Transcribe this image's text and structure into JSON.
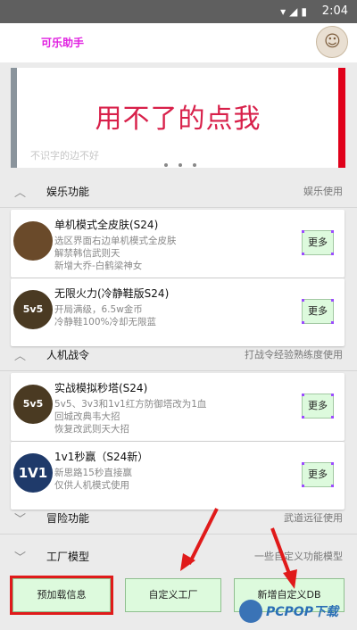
{
  "status_bar": {
    "time": "2:04",
    "icons": [
      "wifi-icon",
      "signal-icon",
      "battery-icon"
    ]
  },
  "app": {
    "title": "可乐助手",
    "avatar_icon": "avatar-icon"
  },
  "banner": {
    "text": "用不了的点我",
    "subtext": "不识字的边不好"
  },
  "sections": [
    {
      "title": "娱乐功能",
      "note": "娱乐使用",
      "icon": "chevron-up-icon"
    },
    {
      "title": "人机战令",
      "note": "打战令经验熟练度使用",
      "icon": "chevron-up-icon"
    },
    {
      "title": "冒险功能",
      "note": "武道远征使用",
      "icon": "chevron-down-icon"
    },
    {
      "title": "工厂模型",
      "note": "一些自定义功能模型",
      "icon": "chevron-down-icon"
    }
  ],
  "cards": [
    {
      "title": "单机模式全皮肤(S24)",
      "desc": "选区界面右边单机模式全皮肤\n解禁韩信武则天\n新增大乔-白鹤梁神女",
      "button": "更多",
      "thumb": ""
    },
    {
      "title": "无限火力(冷静鞋版S24)",
      "desc": "开局满级，6.5w金币\n冷静鞋100%冷却无限蓝",
      "button": "更多",
      "thumb": "5v5"
    },
    {
      "title": "实战模拟秒塔(S24)",
      "desc": "5v5、3v3和1v1红方防御塔改为1血\n回城改典韦大招\n恢复改武则天大招",
      "button": "更多",
      "thumb": "5v5"
    },
    {
      "title": "1v1秒赢（S24新）",
      "desc": "新思路15秒直接赢\n仅供人机模式使用",
      "button": "更多",
      "thumb": "1V1"
    }
  ],
  "bottom_buttons": [
    "预加载信息",
    "自定义工厂",
    "新增自定义DB"
  ],
  "watermark": "PCPOP下载",
  "colors": {
    "accent": "#e020e0",
    "button_bg": "#ddfadd",
    "highlight": "#e01a1a",
    "banner_text": "#d8204a"
  }
}
